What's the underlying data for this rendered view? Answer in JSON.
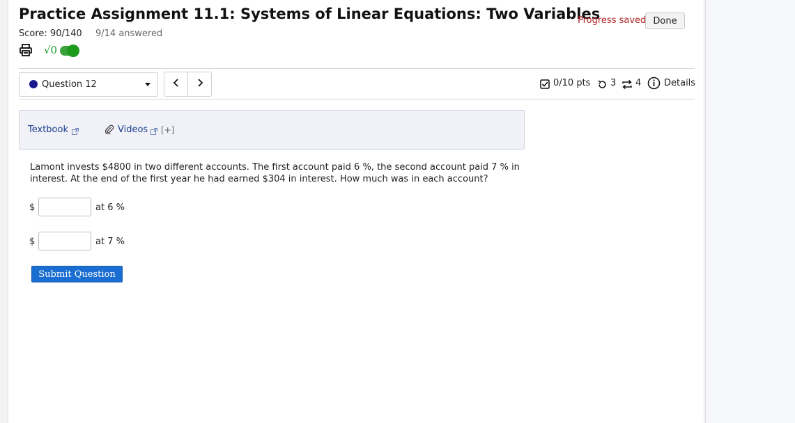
{
  "header": {
    "title": "Practice Assignment 11.1: Systems of Linear Equations: Two Variables",
    "score": "Score: 90/140",
    "answered": "9/14 answered",
    "progress_saved": "Progress saved",
    "done_label": "Done",
    "math_symbol": "√0"
  },
  "toolbar": {
    "question_selected": "Question 12",
    "prev_label": "<",
    "next_label": ">",
    "points": "0/10 pts",
    "retries": "3",
    "attempts": "4",
    "details_label": "Details"
  },
  "resources": {
    "textbook_label": "Textbook",
    "videos_label": "Videos",
    "expand_label": "[+]"
  },
  "question": {
    "text": "Lamont invests $4800 in two different accounts. The first account paid 6 %, the second account paid 7 % in interest. At the end of the first year he had earned $304 in interest. How much was in each account?",
    "currency": "$",
    "answers": [
      {
        "value": "",
        "label": "at 6 %"
      },
      {
        "value": "",
        "label": "at 7 %"
      }
    ],
    "submit_label": "Submit Question"
  },
  "colors": {
    "accent": "#1b6ed1",
    "progress_saved": "#b22222",
    "toggle": "#1b9a1b",
    "question_dot": "#1a1a8c",
    "link": "#1a3c8c"
  },
  "icons": [
    "print-icon",
    "math-entry-icon",
    "toggle-switch",
    "chevron-down-icon",
    "chevron-left-icon",
    "chevron-right-icon",
    "checkbox-icon",
    "retry-icon",
    "attempts-icon",
    "info-icon",
    "external-link-icon",
    "paperclip-icon"
  ]
}
